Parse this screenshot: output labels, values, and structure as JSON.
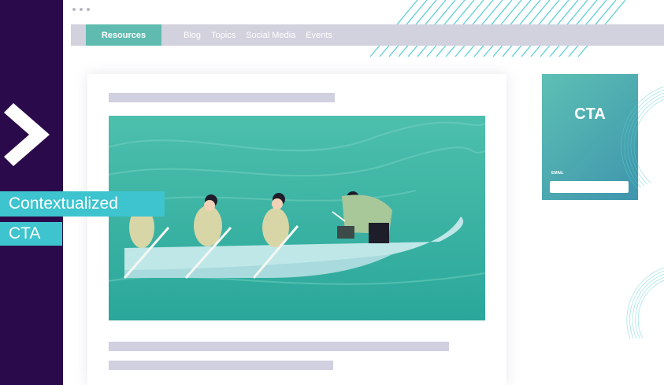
{
  "nav": {
    "active": "Resources",
    "links": [
      "Blog",
      "Topics",
      "Social Media",
      "Events"
    ]
  },
  "cta": {
    "title": "CTA",
    "email_label": "EMAIL"
  },
  "overlay": {
    "line1": "Contextualized",
    "line2": "CTA"
  },
  "colors": {
    "background": "#2a0a4a",
    "accent": "#3ec4cf",
    "nav_active": "#5fbbb0",
    "cta_gradient": [
      "#5dc0b4",
      "#3e95ad"
    ]
  },
  "icons": [
    "chevron-right-icon"
  ]
}
